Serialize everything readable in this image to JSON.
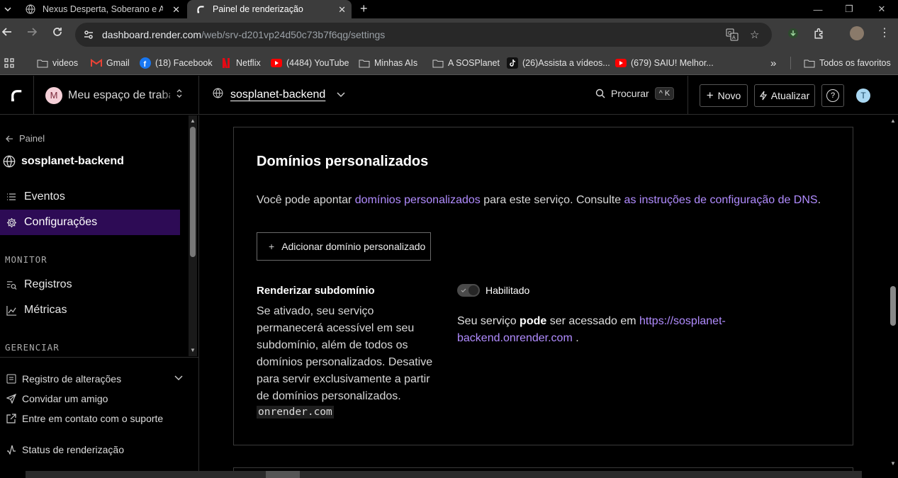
{
  "browser": {
    "tabs": [
      {
        "title": "Nexus Desperta, Soberano e Au",
        "active": false
      },
      {
        "title": "Painel de renderização",
        "active": true
      }
    ],
    "url_host": "dashboard.render.com",
    "url_path": "/web/srv-d201vp24d50c73b7f6qg/settings",
    "bookmarks": [
      {
        "label": "videos",
        "icon": "folder-icon"
      },
      {
        "label": "Gmail",
        "icon": "gmail-icon"
      },
      {
        "label": "(18) Facebook",
        "icon": "facebook-icon"
      },
      {
        "label": "Netflix",
        "icon": "netflix-icon"
      },
      {
        "label": "(4484) YouTube",
        "icon": "youtube-icon"
      },
      {
        "label": "Minhas AIs",
        "icon": "folder-icon"
      },
      {
        "label": "A SOSPlanet",
        "icon": "folder-icon"
      },
      {
        "label": "(26)Assista a vídeos...",
        "icon": "tiktok-icon"
      },
      {
        "label": "(679) SAIU! Melhor...",
        "icon": "youtube-icon"
      }
    ],
    "more_bookmarks": "»",
    "all_favorites": "Todos os favoritos"
  },
  "header": {
    "workspace_initial": "M",
    "workspace_name": "Meu espaço de trabalho",
    "service_name": "sosplanet-backend",
    "search_label": "Procurar",
    "search_shortcut_mod": "^",
    "search_shortcut_key": "K",
    "new_label": "Novo",
    "upgrade_label": "Atualizar",
    "help_label": "?",
    "user_initial": "T"
  },
  "sidebar": {
    "back_label": "Painel",
    "service_name": "sosplanet-backend",
    "items": [
      {
        "label": "Eventos",
        "icon": "list-icon",
        "active": false
      },
      {
        "label": "Configurações",
        "icon": "gear-icon",
        "active": true
      }
    ],
    "monitor_section": "MONITOR",
    "monitor_items": [
      {
        "label": "Registros",
        "icon": "logs-icon"
      },
      {
        "label": "Métricas",
        "icon": "metrics-icon"
      }
    ],
    "manage_section": "GERENCIAR",
    "footer": [
      {
        "label": "Registro de alterações",
        "icon": "changelog-icon"
      },
      {
        "label": "Convidar um amigo",
        "icon": "send-icon"
      },
      {
        "label": "Entre em contato com o suporte",
        "icon": "external-link-icon"
      },
      {
        "label": "Status de renderização",
        "icon": "pulse-icon"
      }
    ]
  },
  "main": {
    "custom_domains": {
      "title": "Domínios personalizados",
      "desc_prefix": "Você pode apontar ",
      "desc_link1": "domínios personalizados",
      "desc_middle": " para este serviço. Consulte ",
      "desc_link2": "as instruções de configuração de DNS",
      "desc_suffix": ".",
      "add_button": "Adicionar domínio personalizado"
    },
    "subdomain": {
      "title": "Renderizar subdomínio",
      "description": "Se ativado, seu serviço permanecerá acessível em seu subdomínio, além de todos os domínios personalizados. Desative para servir exclusivamente a partir de domínios personalizados.",
      "code": "onrender.com",
      "toggle_label": "Habilitado",
      "toggle_on": true,
      "access_prefix": "Seu serviço ",
      "access_bold": "pode",
      "access_middle": " ser acessado em ",
      "access_link": "https://sosplanet-backend.onrender.com",
      "access_suffix": " ."
    }
  }
}
